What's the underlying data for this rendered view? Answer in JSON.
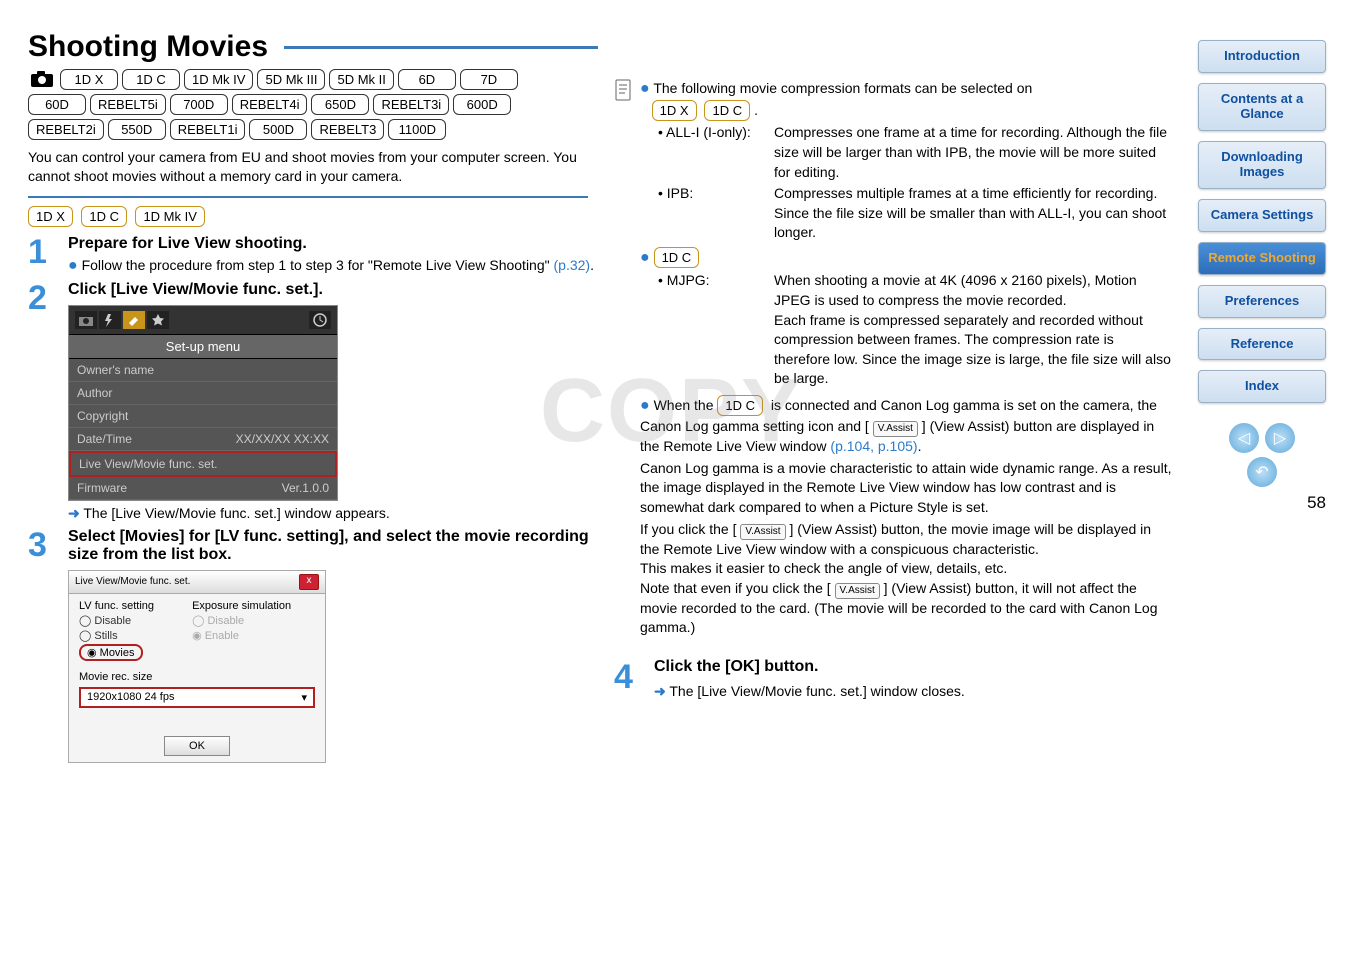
{
  "title": "Shooting Movies",
  "cameras_row": [
    "1D X",
    "1D C",
    "1D Mk IV",
    "5D Mk III",
    "5D Mk II",
    "6D",
    "7D",
    "60D",
    "REBELT5i",
    "700D",
    "REBELT4i",
    "650D",
    "REBELT3i",
    "600D",
    "REBELT2i",
    "550D",
    "REBELT1i",
    "500D",
    "REBELT3",
    "1100D"
  ],
  "intro": "You can control your camera from EU and shoot movies from your computer screen. You cannot shoot movies without a memory card in your camera.",
  "sec_tags": [
    "1D X",
    "1D C",
    "1D Mk IV"
  ],
  "step1": {
    "title": "Prepare for Live View shooting.",
    "bullet": "Follow the procedure from step 1 to step 3 for \"Remote Live View Shooting\" ",
    "link": "(p.32)"
  },
  "step2": {
    "title": "Click [Live View/Movie func. set.].",
    "setup_label": "Set-up menu",
    "rows": {
      "r1": "Owner's name",
      "r2": "Author",
      "r3": "Copyright",
      "r4l": "Date/Time",
      "r4r": "XX/XX/XX   XX:XX",
      "r5": "Live View/Movie func. set.",
      "r6l": "Firmware",
      "r6r": "Ver.1.0.0"
    },
    "result": "The [Live View/Movie func. set.] window appears."
  },
  "step3": {
    "title": "Select [Movies] for [LV func. setting], and select the movie recording size from the list box.",
    "dlg_title": "Live View/Movie func. set.",
    "lv_label": "LV func. setting",
    "exp_label": "Exposure simulation",
    "opt_disable": "Disable",
    "opt_stills": "Stills",
    "opt_movies": "Movies",
    "opt_enable": "Enable",
    "size_label": "Movie rec. size",
    "size_value": "1920x1080 24 fps",
    "ok": "OK"
  },
  "right": {
    "lead": "The following movie compression formats can be selected on ",
    "lead_tags": [
      "1D X",
      "1D C"
    ],
    "all_i_label": "• ALL-I (I-only):",
    "all_i_desc": "Compresses one frame at a time for recording. Although the file size will be larger than with IPB, the movie will be more suited for editing.",
    "ipb_label": "• IPB:",
    "ipb_desc": "Compresses multiple frames at a time efficiently for recording. Since the file size will be smaller than with ALL-I, you can shoot longer.",
    "mjpg_tag": "1D C",
    "mjpg_label": "• MJPG:",
    "mjpg_desc": "When shooting a movie at 4K (4096 x 2160 pixels), Motion JPEG is used to compress the movie recorded.",
    "mjpg_desc2": "Each frame is compressed separately and recorded without compression between frames. The compression rate is therefore low. Since the image size is large, the file size will also be large.",
    "clog_lead1": "When the ",
    "clog_tag": "1D C",
    "clog_lead2": " is connected and Canon Log gamma is set on the camera, the Canon Log gamma setting icon and [ ",
    "clog_lead3": " ] (View Assist) button are displayed in the Remote Live View window ",
    "clog_link": "(p.104, p.105)",
    "clog_p2": "Canon Log gamma is a movie characteristic to attain wide dynamic range. As a result, the image displayed in the Remote Live View window has low contrast and is somewhat dark compared to when a Picture Style is set.",
    "clog_p3a": "If you click the [ ",
    "clog_p3b": " ] (View Assist) button, the movie image will be displayed in the Remote Live View window with a conspicuous characteristic.",
    "clog_p4": "This makes it easier to check the angle of view, details, etc.",
    "clog_p5a": "Note that even if you click the [ ",
    "clog_p5b": " ] (View Assist) button, it will not affect the movie recorded to the card. (The movie will be recorded to the card with Canon Log gamma.)",
    "vassist": "V.Assist"
  },
  "step4": {
    "title": "Click the [OK] button.",
    "result": "The [Live View/Movie func. set.] window closes."
  },
  "nav": {
    "intro": "Introduction",
    "contents": "Contents at a Glance",
    "download": "Downloading Images",
    "settings": "Camera Settings",
    "remote": "Remote Shooting",
    "prefs": "Preferences",
    "ref": "Reference",
    "index": "Index"
  },
  "page_number": "58",
  "watermark": "COPY"
}
